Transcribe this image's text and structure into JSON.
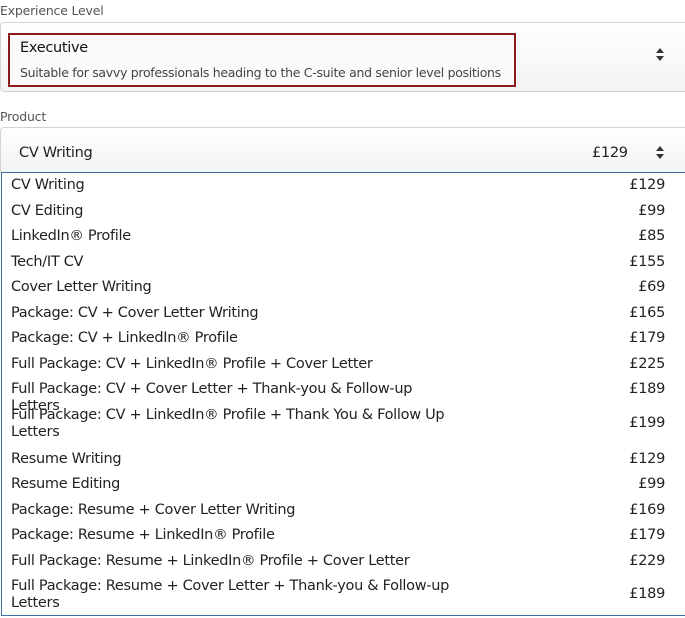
{
  "experience": {
    "label": "Experience Level",
    "selected": {
      "title": "Executive",
      "description": "Suitable for savvy professionals heading to the C-suite and senior level positions"
    },
    "highlight_color": "#8b1a1a"
  },
  "product": {
    "label": "Product",
    "selected": {
      "name": "CV Writing",
      "price": "£129"
    },
    "options": [
      {
        "name": "CV Writing",
        "price": "£129"
      },
      {
        "name": "CV Editing",
        "price": "£99"
      },
      {
        "name": "LinkedIn® Profile",
        "price": "£85"
      },
      {
        "name": "Tech/IT CV",
        "price": "£155"
      },
      {
        "name": "Cover Letter Writing",
        "price": "£69"
      },
      {
        "name": "Package: CV + Cover Letter Writing",
        "price": "£165"
      },
      {
        "name": "Package: CV + LinkedIn® Profile",
        "price": "£179"
      },
      {
        "name": "Full Package: CV + LinkedIn® Profile + Cover Letter",
        "price": "£225"
      },
      {
        "name": "Full Package: CV + Cover Letter + Thank-you & Follow-up Letters",
        "price": "£189"
      },
      {
        "name": "Full Package: CV + LinkedIn® Profile + Thank You & Follow Up Letters",
        "price": "£199"
      },
      {
        "name": "Resume Writing",
        "price": "£129"
      },
      {
        "name": "Resume Editing",
        "price": "£99"
      },
      {
        "name": "Package: Resume + Cover Letter Writing",
        "price": "£169"
      },
      {
        "name": "Package: Resume + LinkedIn® Profile",
        "price": "£179"
      },
      {
        "name": "Full Package: Resume + LinkedIn® Profile + Cover Letter",
        "price": "£229"
      },
      {
        "name": "Full Package: Resume + Cover Letter + Thank-you & Follow-up Letters",
        "price": "£189"
      }
    ],
    "list_border_color": "#3a6ea5"
  }
}
